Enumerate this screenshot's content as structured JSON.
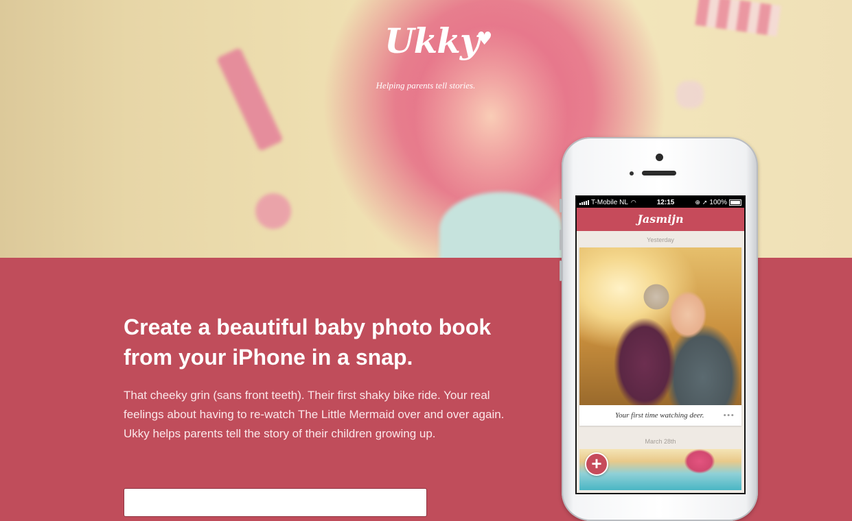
{
  "hero": {
    "logo": "Ukky",
    "tagline": "Helping parents tell stories."
  },
  "content": {
    "headline": "Create a beautiful baby photo book from your iPhone in a snap.",
    "paragraph": "That cheeky grin (sans front teeth). Their first shaky bike ride. Your real feelings about having to re-watch The Little Mermaid over and over again. Ukky helps parents tell the story of their children growing up."
  },
  "phone": {
    "status": {
      "carrier": "T-Mobile NL",
      "time": "12:15",
      "battery": "100%"
    },
    "app_title": "Jasmijn",
    "section1": "Yesterday",
    "caption": "Your first time watching deer.",
    "more": "•••",
    "section2": "March 28th",
    "add_button": "+"
  },
  "colors": {
    "brand": "#c04d5b",
    "navbar": "#c64b5b"
  }
}
